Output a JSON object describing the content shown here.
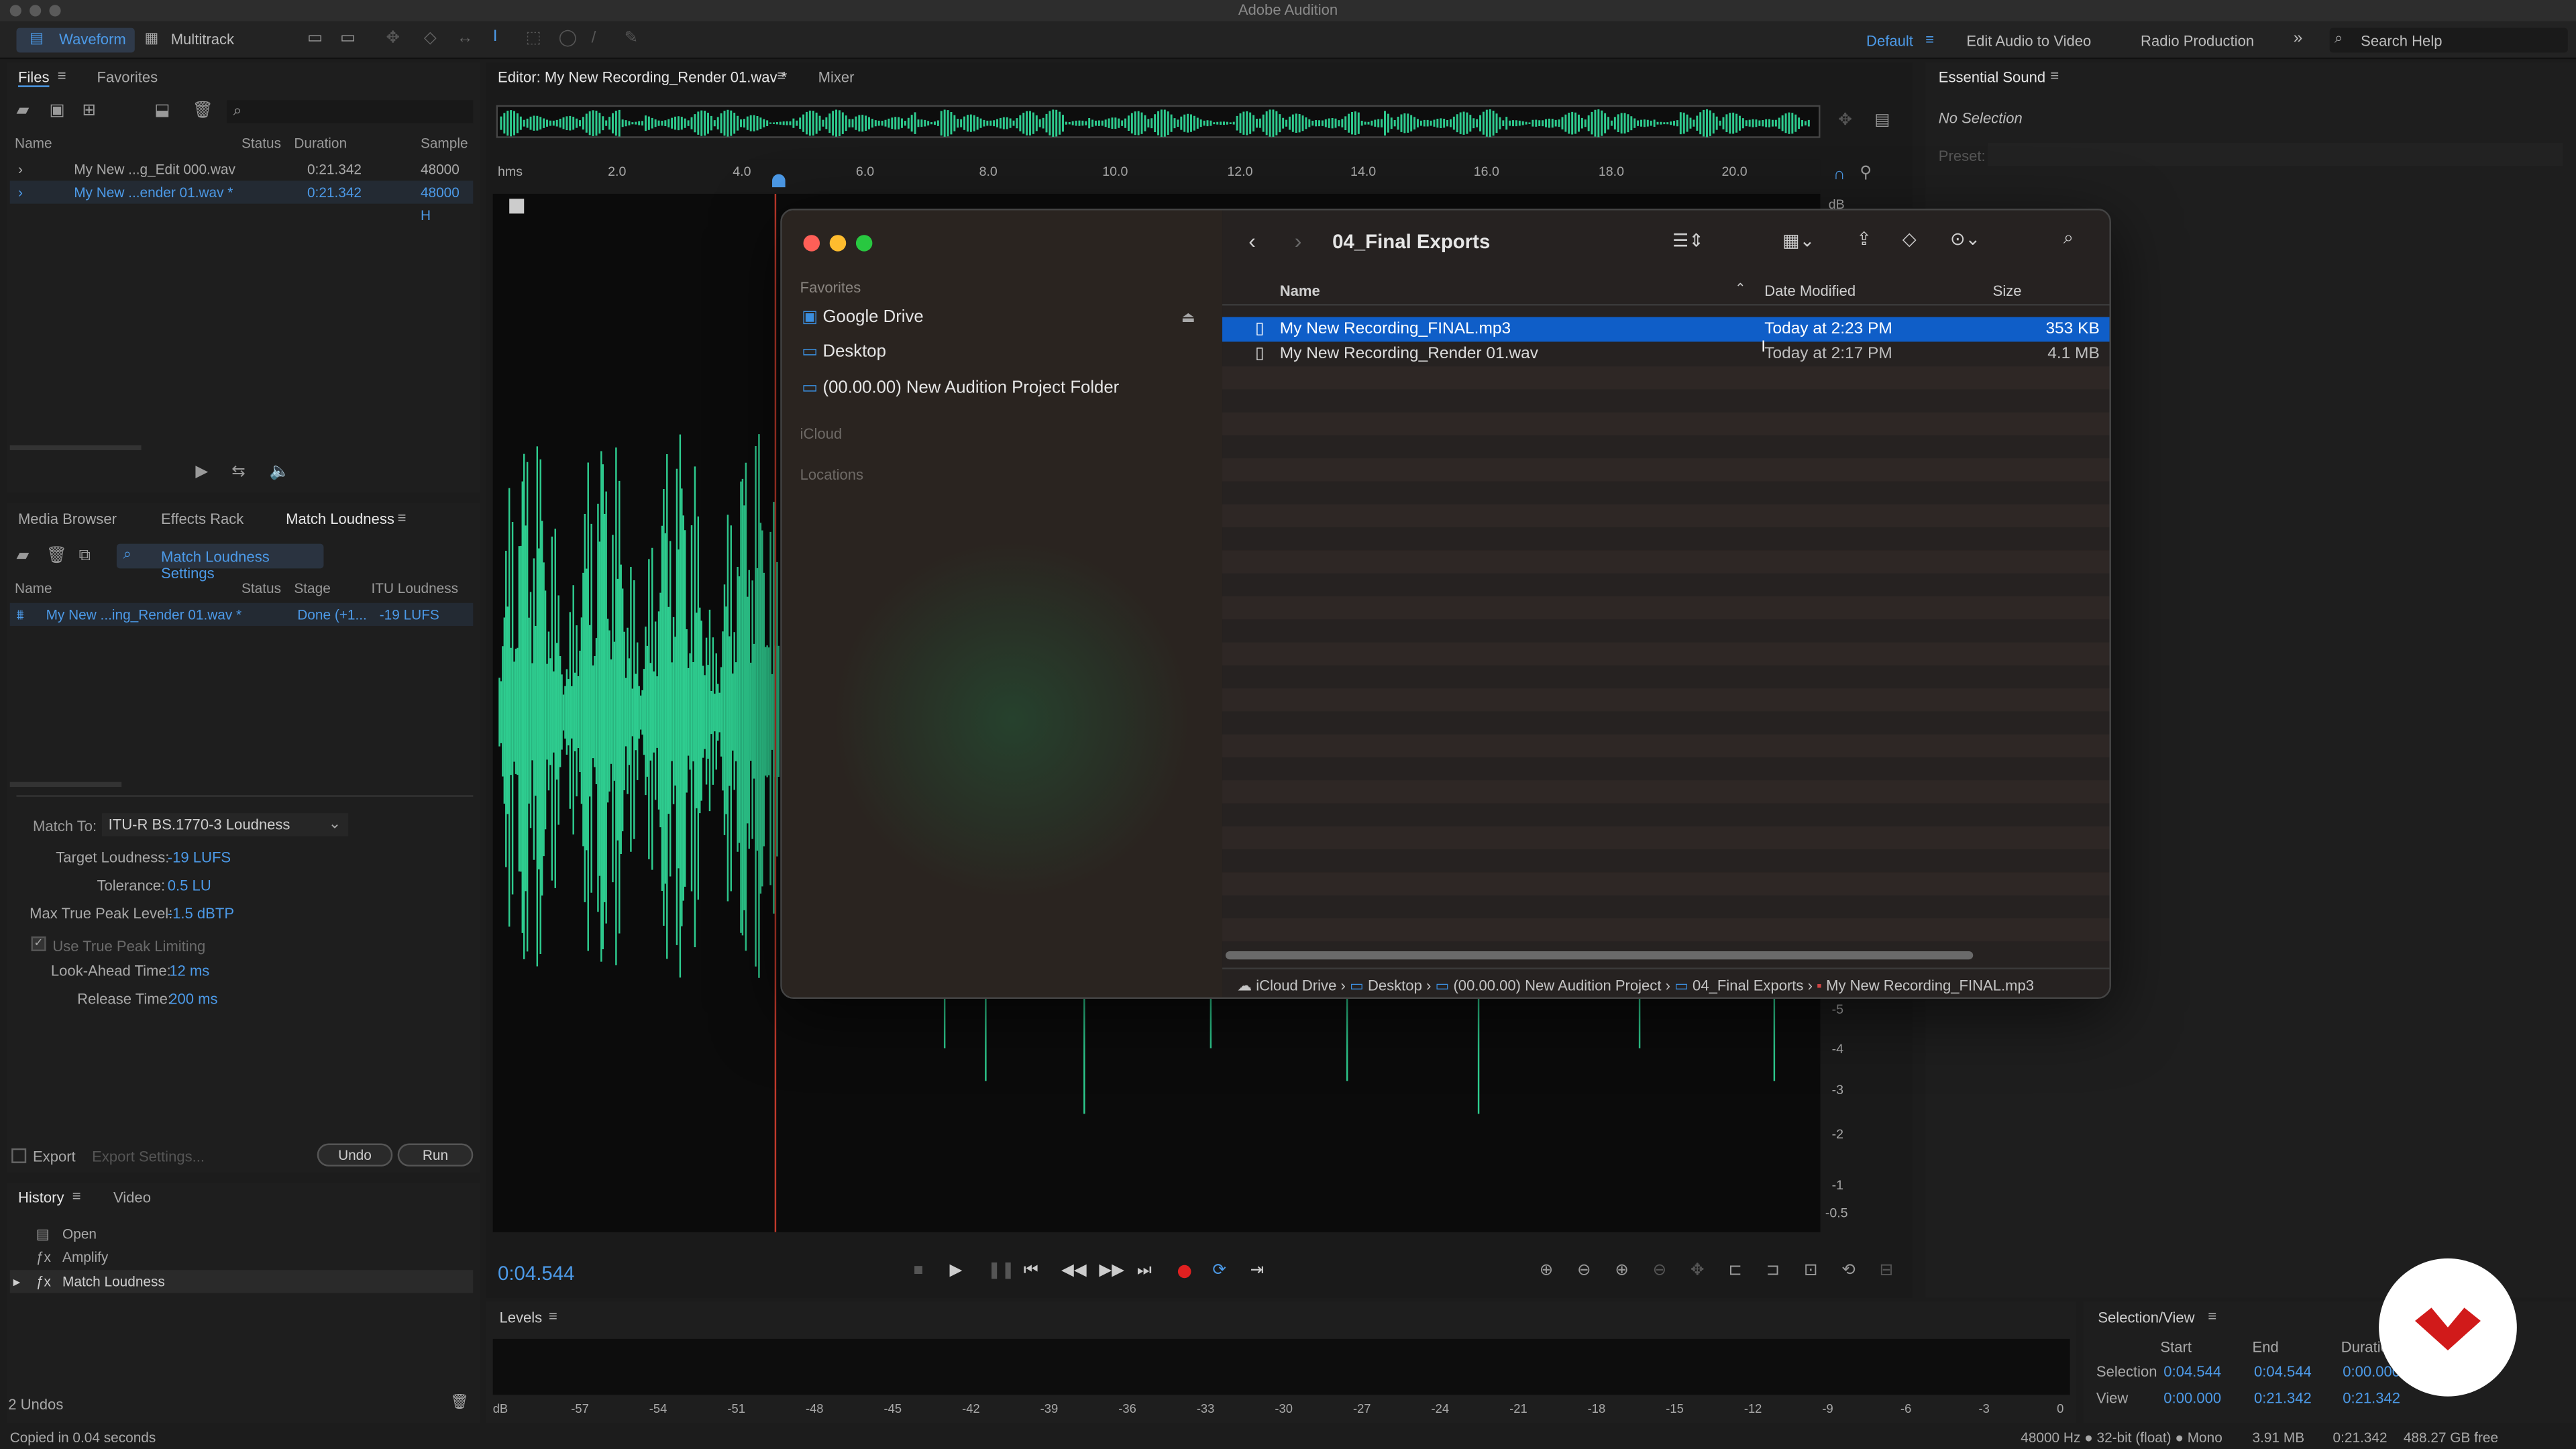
{
  "app": {
    "title": "Adobe Audition"
  },
  "toolbar": {
    "waveform": "Waveform",
    "multitrack": "Multitrack",
    "workspace": "Default",
    "edit_audio_to_video": "Edit Audio to Video",
    "radio_production": "Radio Production",
    "search_placeholder": "Search Help"
  },
  "files": {
    "tab_files": "Files",
    "tab_favorites": "Favorites",
    "col_name": "Name",
    "col_status": "Status",
    "col_duration": "Duration",
    "col_sample": "Sample",
    "rows": [
      {
        "name": "My New ...g_Edit 000.wav",
        "duration": "0:21.342",
        "sample": "48000 H"
      },
      {
        "name": "My New ...ender 01.wav *",
        "duration": "0:21.342",
        "sample": "48000 H"
      }
    ]
  },
  "editor": {
    "tab_editor": "Editor: My New Recording_Render 01.wav *",
    "tab_mixer": "Mixer",
    "time_unit": "hms",
    "ticks": [
      "2.0",
      "4.0",
      "6.0",
      "8.0",
      "10.0",
      "12.0",
      "14.0",
      "16.0",
      "18.0",
      "20.0"
    ],
    "db_labels": [
      "dB",
      "-5",
      "-4",
      "-3",
      "-2",
      "-1",
      "-0.5"
    ],
    "current_time": "0:04.544"
  },
  "match": {
    "tab_media": "Media Browser",
    "tab_effects": "Effects Rack",
    "tab_match": "Match Loudness",
    "settings": "Match Loudness Settings",
    "col_name": "Name",
    "col_status": "Status",
    "col_stage": "Stage",
    "col_itu": "ITU Loudness",
    "row": {
      "name": "My New ...ing_Render 01.wav *",
      "stage": "Done (+1...",
      "itu": "-19 LUFS"
    },
    "match_to_label": "Match To:",
    "match_to_value": "ITU-R BS.1770-3 Loudness",
    "target_label": "Target Loudness:",
    "target_value": "-19 LUFS",
    "tolerance_label": "Tolerance:",
    "tolerance_value": "0.5 LU",
    "peak_label": "Max True Peak Level:",
    "peak_value": "-1.5 dBTP",
    "true_peak": "Use True Peak Limiting",
    "lookahead_label": "Look-Ahead Time:",
    "lookahead_value": "12 ms",
    "release_label": "Release Time:",
    "release_value": "200 ms",
    "export": "Export",
    "export_settings": "Export Settings...",
    "undo": "Undo",
    "run": "Run"
  },
  "history": {
    "tab_history": "History",
    "tab_video": "Video",
    "items": [
      "Open",
      "Amplify",
      "Match Loudness"
    ],
    "undos": "2 Undos"
  },
  "essential": {
    "title": "Essential Sound",
    "no_selection": "No Selection",
    "preset": "Preset:"
  },
  "levels": {
    "title": "Levels",
    "scale": [
      "dB",
      "-57",
      "-54",
      "-51",
      "-48",
      "-45",
      "-42",
      "-39",
      "-36",
      "-33",
      "-30",
      "-27",
      "-24",
      "-21",
      "-18",
      "-15",
      "-12",
      "-9",
      "-6",
      "-3",
      "0"
    ]
  },
  "selview": {
    "title": "Selection/View",
    "col_start": "Start",
    "col_end": "End",
    "col_duration": "Duration",
    "selection_label": "Selection",
    "view_label": "View",
    "sel_start": "0:04.544",
    "sel_end": "0:04.544",
    "sel_dur": "0:00.000",
    "view_start": "0:00.000",
    "view_end": "0:21.342",
    "view_dur": "0:21.342"
  },
  "status": {
    "left": "Copied in 0.04 seconds",
    "format": "48000 Hz ● 32-bit (float) ● Mono",
    "size": "3.91 MB",
    "duration": "0:21.342",
    "free": "488.27 GB free"
  },
  "dialog": {
    "folder": "04_Final Exports",
    "sidebar_favorites": "Favorites",
    "google_drive": "Google Drive",
    "desktop": "Desktop",
    "project_folder": "(00.00.00) New Audition Project Folder",
    "icloud": "iCloud",
    "locations": "Locations",
    "col_name": "Name",
    "col_date": "Date Modified",
    "col_size": "Size",
    "files": [
      {
        "name": "My New Recording_FINAL.mp3",
        "date": "Today at 2:23 PM",
        "size": "353 KB"
      },
      {
        "name": "My New Recording_Render 01.wav",
        "date": "Today at 2:17 PM",
        "size": "4.1 MB"
      }
    ],
    "path": [
      "iCloud Drive",
      "Desktop",
      "(00.00.00) New Audition Project",
      "04_Final Exports",
      "My New Recording_FINAL.mp3"
    ]
  },
  "colors": {
    "accent": "#4c9ae8",
    "wave": "#2ecc8f",
    "selection": "#0f5ec8",
    "record": "#e02020",
    "logo": "#d11a1a"
  }
}
